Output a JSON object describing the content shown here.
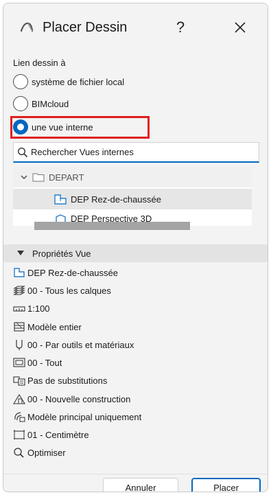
{
  "window": {
    "title": "Placer Dessin",
    "help_label": "?",
    "app_icon": "archicad-arc-icon",
    "close_icon": "close-icon"
  },
  "link": {
    "section_label": "Lien dessin à",
    "options": [
      {
        "label": "système de fichier local",
        "selected": false
      },
      {
        "label": "BIMcloud",
        "selected": false
      },
      {
        "label": "une vue interne",
        "selected": true
      }
    ],
    "highlight_color": "#e01d1d"
  },
  "search": {
    "placeholder": "Rechercher Vues internes",
    "value": ""
  },
  "tree": {
    "folder_label": "DEPART",
    "selected_item": "DEP Rez-de-chaussée",
    "partial_item": "DEP Perspective 3D"
  },
  "properties": {
    "header_label": "Propriétés Vue",
    "items": [
      {
        "icon": "floor-plan-icon",
        "label": "DEP Rez-de-chaussée"
      },
      {
        "icon": "layers-icon",
        "label": "00 - Tous les calques"
      },
      {
        "icon": "scale-ruler-icon",
        "label": "1:100"
      },
      {
        "icon": "structure-display-icon",
        "label": "Modèle entier"
      },
      {
        "icon": "pen-set-icon",
        "label": "00 - Par outils et matériaux"
      },
      {
        "icon": "model-view-options-icon",
        "label": "00 - Tout"
      },
      {
        "icon": "graphic-override-icon",
        "label": "Pas de substitutions"
      },
      {
        "icon": "renovation-filter-icon",
        "label": "00 - Nouvelle construction"
      },
      {
        "icon": "hotlink-icon",
        "label": "Modèle principal uniquement"
      },
      {
        "icon": "dimension-icon",
        "label": "01 - Centimètre"
      },
      {
        "icon": "zoom-icon",
        "label": "Optimiser"
      }
    ]
  },
  "buttons": {
    "cancel_label": "Annuler",
    "place_label": "Placer"
  },
  "colors": {
    "accent": "#0067c0",
    "background": "#f3f3f3"
  }
}
